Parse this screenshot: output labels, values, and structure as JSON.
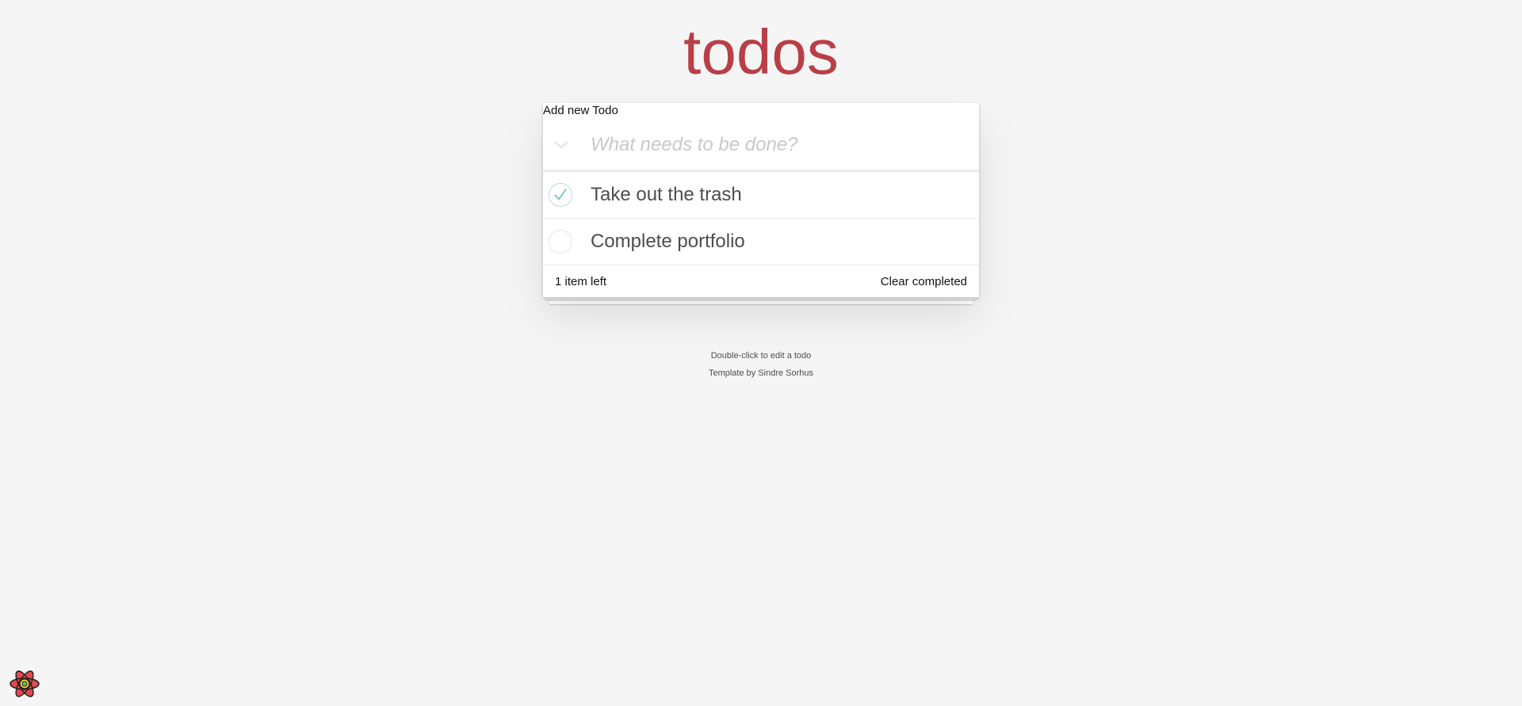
{
  "header": {
    "title": "todos",
    "add_label": "Add new Todo"
  },
  "new_todo": {
    "value": "",
    "placeholder": "What needs to be done?",
    "toggle_all_icon": "chevron-down-icon"
  },
  "todos": [
    {
      "label": "Take out the trash",
      "completed": true
    },
    {
      "label": "Complete portfolio",
      "completed": false
    }
  ],
  "footer": {
    "items_left": "1 item left",
    "clear_completed_label": "Clear completed"
  },
  "info": {
    "edit_hint": "Double-click to edit a todo",
    "template_prefix": "Template by ",
    "template_author": "Sindre Sorhus"
  },
  "devtools": {
    "icon": "react-logo-icon"
  },
  "colors": {
    "title": "#b83f45",
    "background": "#f5f5f5",
    "checkmark": "#5dc2af",
    "checked_circle_border": "#bddad5"
  }
}
